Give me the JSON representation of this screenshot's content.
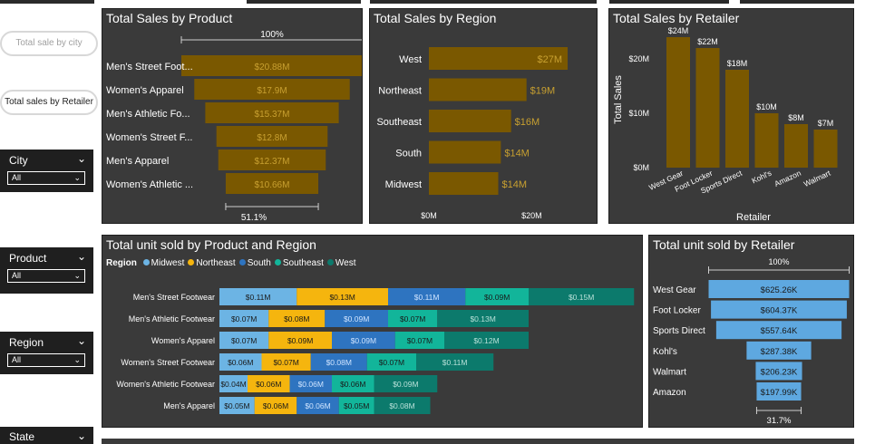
{
  "buttons": {
    "city_label": "Total sale by city",
    "retailer_label": "Total sales by Retailer"
  },
  "slicers": [
    {
      "title": "City",
      "value": "All"
    },
    {
      "title": "Product",
      "value": "All"
    },
    {
      "title": "Region",
      "value": "All"
    },
    {
      "title": "State"
    }
  ],
  "colors": {
    "panel": "#3a3a3a",
    "gold": "#7a5800",
    "gold_text": "#c8a030",
    "light_blue": "#5ea8e0",
    "midwest": "#6cb4e4",
    "northeast": "#f5b50e",
    "south": "#2e74c0",
    "southeast": "#12b59a",
    "west": "#0c7a6c"
  },
  "product_funnel": {
    "title": "Total Sales by Product",
    "top_pct": "100%",
    "bottom_pct": "51.1%",
    "max": 20.88,
    "items": [
      {
        "label": "Men's Street Foot...",
        "value": 20.88,
        "text": "$20.88M"
      },
      {
        "label": "Women's Apparel",
        "value": 17.9,
        "text": "$17.9M"
      },
      {
        "label": "Men's Athletic Fo...",
        "value": 15.37,
        "text": "$15.37M"
      },
      {
        "label": "Women's Street F...",
        "value": 12.8,
        "text": "$12.8M"
      },
      {
        "label": "Men's Apparel",
        "value": 12.37,
        "text": "$12.37M"
      },
      {
        "label": "Women's Athletic ...",
        "value": 10.66,
        "text": "$10.66M"
      }
    ]
  },
  "region_bars": {
    "title": "Total Sales by Region",
    "max": 30,
    "ticks": [
      {
        "value": 0,
        "label": "$0M"
      },
      {
        "value": 20,
        "label": "$20M"
      }
    ],
    "items": [
      {
        "label": "West",
        "value": 27,
        "text": "$27M"
      },
      {
        "label": "Northeast",
        "value": 19,
        "text": "$19M"
      },
      {
        "label": "Southeast",
        "value": 16,
        "text": "$16M"
      },
      {
        "label": "South",
        "value": 14,
        "text": "$14M"
      },
      {
        "label": "Midwest",
        "value": 13.5,
        "text": "$14M"
      }
    ]
  },
  "retailer_columns": {
    "title": "Total Sales by Retailer",
    "ylabel": "Total Sales",
    "xlabel": "Retailer",
    "max": 25,
    "ticks": [
      {
        "value": 0,
        "label": "$0M"
      },
      {
        "value": 10,
        "label": "$10M"
      },
      {
        "value": 20,
        "label": "$20M"
      }
    ],
    "items": [
      {
        "label": "West Gear",
        "value": 24,
        "text": "$24M"
      },
      {
        "label": "Foot Locker",
        "value": 22,
        "text": "$22M"
      },
      {
        "label": "Sports Direct",
        "value": 18,
        "text": "$18M"
      },
      {
        "label": "Kohl's",
        "value": 10,
        "text": "$10M"
      },
      {
        "label": "Amazon",
        "value": 8,
        "text": "$8M"
      },
      {
        "label": "Walmart",
        "value": 7,
        "text": "$7M"
      }
    ]
  },
  "stacked": {
    "title": "Total unit sold by Product and Region",
    "legend_title": "Region",
    "series": [
      {
        "name": "Midwest",
        "color": "#6cb4e4"
      },
      {
        "name": "Northeast",
        "color": "#f5b50e"
      },
      {
        "name": "South",
        "color": "#2e74c0"
      },
      {
        "name": "Southeast",
        "color": "#12b59a"
      },
      {
        "name": "West",
        "color": "#0c7a6c"
      }
    ],
    "rows": [
      {
        "label": "Men's Street Footwear",
        "values": [
          0.11,
          0.13,
          0.11,
          0.09,
          0.15
        ],
        "texts": [
          "$0.11M",
          "$0.13M",
          "$0.11M",
          "$0.09M",
          "$0.15M"
        ]
      },
      {
        "label": "Men's Athletic Footwear",
        "values": [
          0.07,
          0.08,
          0.09,
          0.07,
          0.13
        ],
        "texts": [
          "$0.07M",
          "$0.08M",
          "$0.09M",
          "$0.07M",
          "$0.13M"
        ]
      },
      {
        "label": "Women's Apparel",
        "values": [
          0.07,
          0.09,
          0.09,
          0.07,
          0.12
        ],
        "texts": [
          "$0.07M",
          "$0.09M",
          "$0.09M",
          "$0.07M",
          "$0.12M"
        ]
      },
      {
        "label": "Women's Street Footwear",
        "values": [
          0.06,
          0.07,
          0.08,
          0.07,
          0.11
        ],
        "texts": [
          "$0.06M",
          "$0.07M",
          "$0.08M",
          "$0.07M",
          "$0.11M"
        ]
      },
      {
        "label": "Women's Athletic Footwear",
        "values": [
          0.04,
          0.06,
          0.06,
          0.06,
          0.09
        ],
        "texts": [
          "$0.04M",
          "$0.06M",
          "$0.06M",
          "$0.06M",
          "$0.09M"
        ]
      },
      {
        "label": "Men's Apparel",
        "values": [
          0.05,
          0.06,
          0.06,
          0.05,
          0.08
        ],
        "texts": [
          "$0.05M",
          "$0.06M",
          "$0.06M",
          "$0.05M",
          "$0.08M"
        ]
      }
    ]
  },
  "units_funnel": {
    "title": "Total unit sold by Retailer",
    "top_pct": "100%",
    "bottom_pct": "31.7%",
    "max": 625.26,
    "items": [
      {
        "label": "West Gear",
        "value": 625.26,
        "text": "$625.26K"
      },
      {
        "label": "Foot Locker",
        "value": 604.37,
        "text": "$604.37K"
      },
      {
        "label": "Sports Direct",
        "value": 557.64,
        "text": "$557.64K"
      },
      {
        "label": "Kohl's",
        "value": 287.38,
        "text": "$287.38K"
      },
      {
        "label": "Walmart",
        "value": 206.23,
        "text": "$206.23K"
      },
      {
        "label": "Amazon",
        "value": 197.99,
        "text": "$197.99K"
      }
    ]
  }
}
